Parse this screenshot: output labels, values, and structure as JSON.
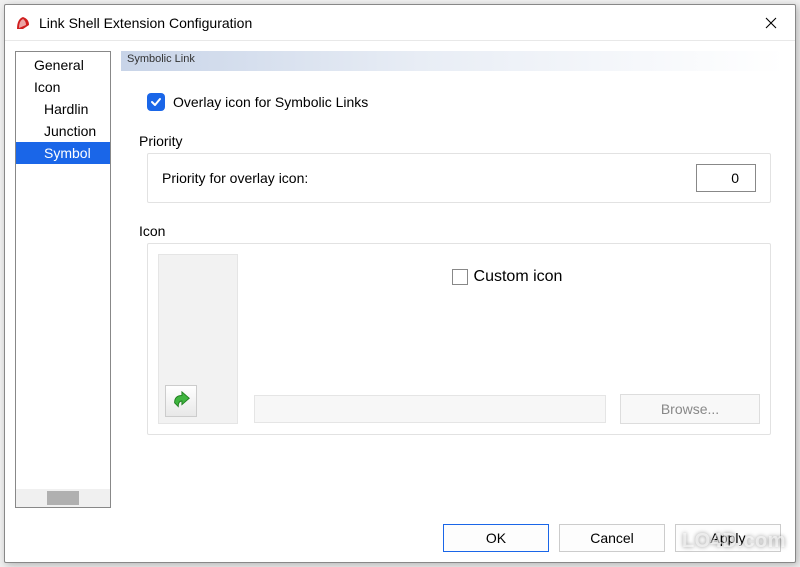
{
  "window": {
    "title": "Link Shell Extension Configuration",
    "close": "Close"
  },
  "tree": {
    "items": [
      {
        "label": "General"
      },
      {
        "label": "Icon"
      },
      {
        "label": "Hardlin"
      },
      {
        "label": "Junction"
      },
      {
        "label": "Symbol"
      }
    ]
  },
  "section": {
    "header": "Symbolic Link",
    "overlay_checkbox_label": "Overlay icon for Symbolic Links",
    "priority": {
      "title": "Priority",
      "label": "Priority for overlay icon:",
      "value": "0"
    },
    "icon": {
      "title": "Icon",
      "custom_label": "Custom icon",
      "browse": "Browse...",
      "path": ""
    }
  },
  "buttons": {
    "ok": "OK",
    "cancel": "Cancel",
    "apply": "Apply"
  },
  "watermark": "LO4D.com"
}
